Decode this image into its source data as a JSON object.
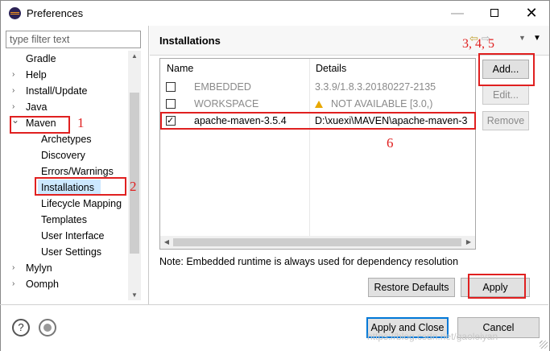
{
  "window": {
    "title": "Preferences",
    "minimize": "—",
    "close": "✕"
  },
  "sidebar": {
    "filter_placeholder": "type filter text",
    "items": [
      {
        "label": "Gradle",
        "chevron": ""
      },
      {
        "label": "Help",
        "chevron": "›"
      },
      {
        "label": "Install/Update",
        "chevron": "›"
      },
      {
        "label": "Java",
        "chevron": "›"
      },
      {
        "label": "Maven",
        "chevron": "⌄"
      },
      {
        "label": "Archetypes"
      },
      {
        "label": "Discovery"
      },
      {
        "label": "Errors/Warnings"
      },
      {
        "label": "Installations"
      },
      {
        "label": "Lifecycle Mapping"
      },
      {
        "label": "Templates"
      },
      {
        "label": "User Interface"
      },
      {
        "label": "User Settings"
      },
      {
        "label": "Mylyn",
        "chevron": "›"
      },
      {
        "label": "Oomph",
        "chevron": "›"
      }
    ]
  },
  "page": {
    "title": "Installations",
    "table": {
      "headers": [
        "Name",
        "Details"
      ],
      "rows": [
        {
          "checked": false,
          "name": "EMBEDDED",
          "details": "3.3.9/1.8.3.20180227-2135",
          "greyed": true
        },
        {
          "checked": false,
          "name": "WORKSPACE",
          "details": "NOT AVAILABLE [3.0,)",
          "greyed": true,
          "warning": true
        },
        {
          "checked": true,
          "name": "apache-maven-3.5.4",
          "details": "D:\\xuexi\\MAVEN\\apache-maven-3",
          "greyed": false
        }
      ]
    },
    "buttons": {
      "add": "Add...",
      "edit": "Edit...",
      "remove": "Remove",
      "restore_defaults": "Restore Defaults",
      "apply": "Apply"
    },
    "note": "Note: Embedded runtime is always used for dependency resolution"
  },
  "footer": {
    "help": "?",
    "apply_and_close": "Apply and Close",
    "cancel": "Cancel",
    "watermark": "https://blog.csdn.net/gaoleiyan"
  },
  "annotations": {
    "a1": "1",
    "a2": "2",
    "a345": "3, 4, 5",
    "a6": "6",
    "color": "#e02020"
  }
}
